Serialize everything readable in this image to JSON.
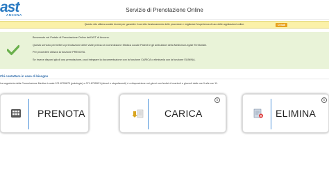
{
  "header": {
    "logo_text": "ast",
    "logo_subtext": "ANCONA",
    "title": "Servizio di Prenotazione Online"
  },
  "cookie_banner": {
    "text": "Questo sito utilizza cookie tecnici per garantire il corretto funzionamento delle procedure e migliorare l'esperienza di uso delle applicazioni online.",
    "button_label": "Chiudi"
  },
  "welcome": {
    "lines": [
      "Benvenuto nel Portale di Prenotazione Online dell'AST di Ancona.",
      "Questo servizio permette la prenotazione delle visite presso la Commissione Medica Locale Patenti e gli ambulatori della Medicina Legale Territoriale.",
      "Per procedere utilizza la funzione PRENOTA.",
      "Se invece disponi già di una prenotazione, puoi integrare la documentazione con la funzione CARICA o eliminarla con la funzione ELIMINA."
    ]
  },
  "contact": {
    "title": "Chi contattare in caso di bisogno",
    "text": "La segreteria della Commissione Medica Locale 071.8705670 (patologie) e 071.8705521 (alcool e stupefacenti) è a disposizione nei giorni non festivi di martedì e giovedì dalle ore 9 alle ore 11."
  },
  "actions": [
    {
      "label": "PRENOTA",
      "icon": "calculator-icon"
    },
    {
      "label": "CARICA",
      "icon": "upload-document-icon"
    },
    {
      "label": "ELIMINA",
      "icon": "delete-document-icon"
    }
  ],
  "colors": {
    "brand": "#2a7ac2",
    "cookie_bg": "#fbf1a8",
    "cookie_button": "#e8a21c",
    "welcome_bg": "#e9f3d8",
    "check": "#6ab04c",
    "divider": "#4a90d9"
  }
}
